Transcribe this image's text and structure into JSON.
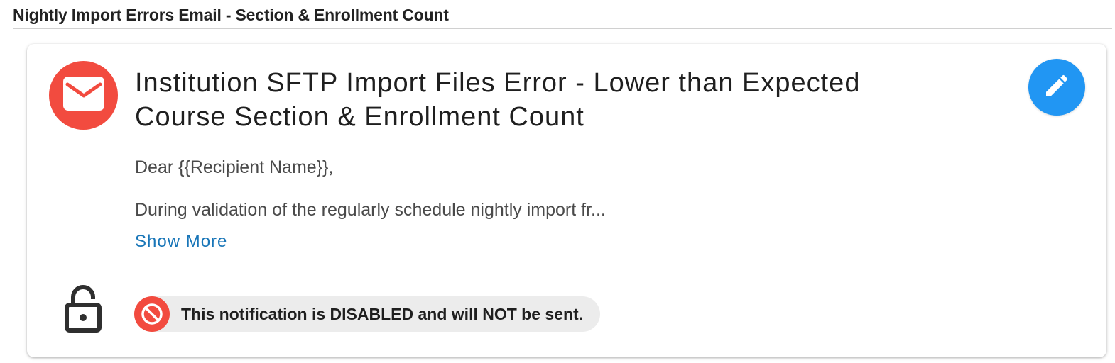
{
  "section": {
    "title": "Nightly Import Errors Email - Section & Enrollment Count"
  },
  "notification": {
    "avatar_icon": "mail-icon",
    "subject": "Institution SFTP Import Files Error - Lower than Expected Course Section & Enrollment Count",
    "greeting": "Dear {{Recipient Name}},",
    "body_preview": "During validation of the regularly schedule nightly import fr...",
    "show_more_label": "Show More",
    "edit_icon": "pencil-icon",
    "lock_icon": "lock-open-icon",
    "status": {
      "icon": "block-icon",
      "text": "This notification is DISABLED and will NOT be sent."
    }
  },
  "colors": {
    "danger": "#f24b3f",
    "primary": "#2196f3",
    "link": "#1976b8"
  }
}
